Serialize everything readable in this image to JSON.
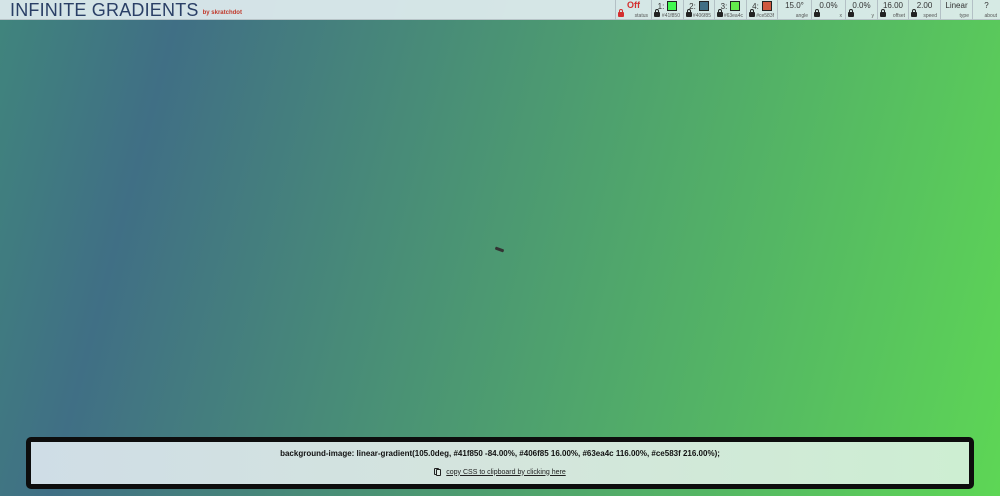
{
  "brand": {
    "title": "INFINITE GRADIENTS",
    "by": "by skratchdot"
  },
  "controls": {
    "status": {
      "value": "Off",
      "label": "status"
    },
    "colors": [
      {
        "num": "1:",
        "hex": "#41f850",
        "label": "#41f850"
      },
      {
        "num": "2:",
        "hex": "#406f85",
        "label": "#406f85"
      },
      {
        "num": "3:",
        "hex": "#63ea4c",
        "label": "#63ea4c"
      },
      {
        "num": "4:",
        "hex": "#ce583f",
        "label": "#ce583f"
      }
    ],
    "angle": {
      "value": "15.0°",
      "label": "angle"
    },
    "x": {
      "value": "0.0%",
      "label": "x"
    },
    "y": {
      "value": "0.0%",
      "label": "y"
    },
    "offset": {
      "value": "16.00",
      "label": "offset"
    },
    "speed": {
      "value": "2.00",
      "label": "speed"
    },
    "type": {
      "value": "Linear",
      "label": "type"
    },
    "about": {
      "value": "?",
      "label": "about"
    }
  },
  "css_panel": {
    "css_text": "background-image: linear-gradient(105.0deg, #41f850 -84.00%, #406f85 16.00%, #63ea4c 116.00%, #ce583f 216.00%);",
    "copy_label": "copy CSS to clipboard by clicking here"
  },
  "colors": {
    "header_bg": "#e1edf0",
    "status_off": "#d32f2f",
    "brand": "#2a3f66"
  }
}
